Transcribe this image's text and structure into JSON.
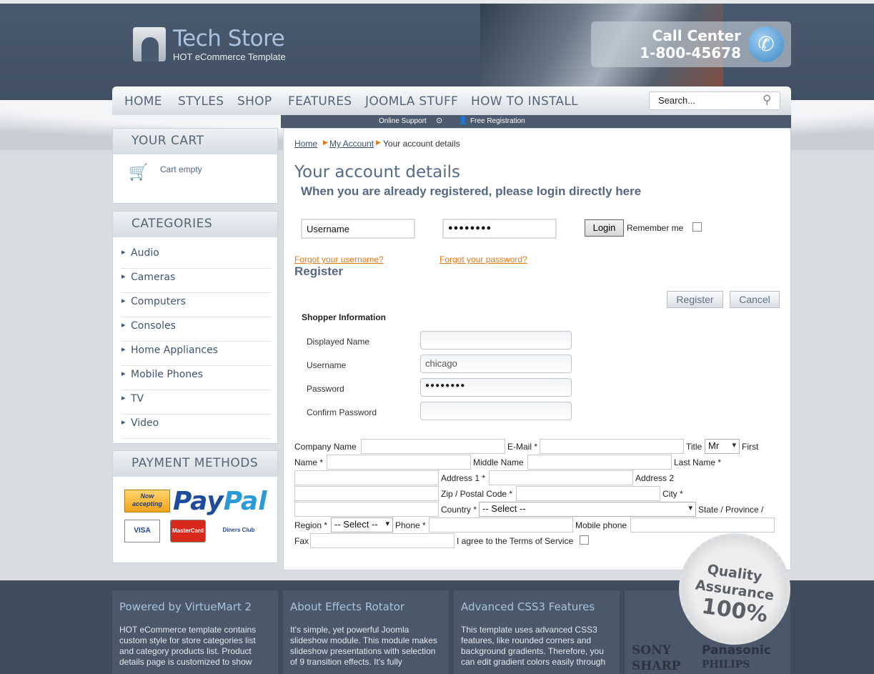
{
  "brand": {
    "title": "Tech Store",
    "subtitle": "HOT eCommerce Template"
  },
  "callcenter": {
    "label": "Call Center",
    "number": "1-800-45678"
  },
  "nav": {
    "items": [
      "HOME",
      "STYLES",
      "SHOP",
      "FEATURES",
      "JOOMLA STUFF",
      "HOW TO INSTALL"
    ]
  },
  "search": {
    "value": "Search..."
  },
  "subbar": {
    "online_support": "Online Support",
    "free_registration": "Free Registration"
  },
  "cart": {
    "title": "YOUR CART",
    "status": "Cart empty"
  },
  "categories": {
    "title": "CATEGORIES",
    "items": [
      "Audio",
      "Cameras",
      "Computers",
      "Consoles",
      "Home Appliances",
      "Mobile Phones",
      "TV",
      "Video"
    ]
  },
  "payment": {
    "title": "PAYMENT METHODS",
    "now_accepting": "Now accepting",
    "paypal_a": "Pay",
    "paypal_b": "Pal",
    "visa": "VISA",
    "mastercard": "MasterCard",
    "diners": "Diners Club"
  },
  "breadcrumb": {
    "home": "Home",
    "account": "My Account",
    "current": "Your account details"
  },
  "page": {
    "title": "Your account details",
    "login_heading": "When you are already registered, please login directly here"
  },
  "login": {
    "username": "Username",
    "password_mask": "●●●●●●●●",
    "login_button": "Login",
    "remember": "Remember me",
    "forgot_username": "Forgot your username?",
    "forgot_password": "Forgot your password?"
  },
  "register": {
    "title": "Register",
    "register_button": "Register",
    "cancel_button": "Cancel",
    "shopper_heading": "Shopper Information",
    "labels": {
      "displayed_name": "Displayed Name",
      "username": "Username",
      "password": "Password",
      "confirm_password": "Confirm Password"
    },
    "values": {
      "username": "chicago",
      "password": "●●●●●●●●"
    }
  },
  "address_form": {
    "company": "Company Name",
    "email": "E-Mail *",
    "title": "Title",
    "title_value": "Mr",
    "first_a": "First",
    "first_b": "Name *",
    "middle": "Middle Name",
    "last": "Last Name *",
    "address1": "Address 1 *",
    "address2": "Address 2",
    "zip": "Zip / Postal Code *",
    "city": "City *",
    "country": "Country *",
    "country_value": "-- Select --",
    "state_a": "State / Province /",
    "state_b": "Region *",
    "state_value": "-- Select --",
    "phone": "Phone *",
    "mobile": "Mobile phone",
    "fax": "Fax",
    "terms": "I agree to the Terms of Service"
  },
  "footer": {
    "col1_title": "Powered by VirtueMart 2",
    "col1_text": "HOT eCommerce template contains custom style for store categories list and category products list. Product details page is customized to show",
    "col2_title": "About Effects Rotator",
    "col2_text": "It's simple, yet powerful Joomla slideshow module. This module makes slideshow presentations with selection of 9 transition effects. It's fully",
    "col3_title": "Advanced CSS3 Features",
    "col3_text": "This template uses advanced CSS3 features, like rounded corners and background gradients. Therefore, you can edit gradient colors easily through",
    "brands": [
      "SONY",
      "Panasonic",
      "SHARP",
      "PHILIPS"
    ]
  },
  "badge": {
    "line1": "Quality",
    "line2": "Assurance",
    "line3": "100%"
  }
}
